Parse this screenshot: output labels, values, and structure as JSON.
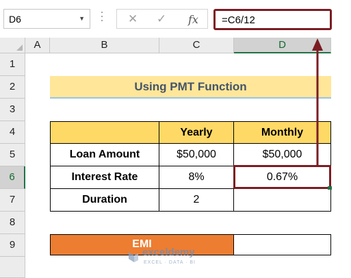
{
  "formula_bar": {
    "name_box": "D6",
    "cancel_icon": "✕",
    "enter_icon": "✓",
    "fx_label": "fx",
    "formula": "=C6/12"
  },
  "columns": [
    "A",
    "B",
    "C",
    "D"
  ],
  "rows": [
    "1",
    "2",
    "3",
    "4",
    "5",
    "6",
    "7",
    "8",
    "9"
  ],
  "selected": {
    "column": "D",
    "row": "6"
  },
  "sheet": {
    "title": "Using PMT Function",
    "headers": {
      "yearly": "Yearly",
      "monthly": "Monthly"
    },
    "table": [
      {
        "label": "Loan Amount",
        "yearly": "$50,000",
        "monthly": "$50,000"
      },
      {
        "label": "Interest Rate",
        "yearly": "8%",
        "monthly": "0.67%"
      },
      {
        "label": "Duration",
        "yearly": "2",
        "monthly": ""
      }
    ],
    "emi_label": "EMI",
    "emi_value": ""
  },
  "watermark": {
    "name": "exceldemy",
    "tagline": "EXCEL · DATA · BI"
  },
  "colors": {
    "annotation": "#7b1c22",
    "title_fill": "#ffe699",
    "header_fill": "#ffd966",
    "emi_fill": "#ed7d31"
  }
}
